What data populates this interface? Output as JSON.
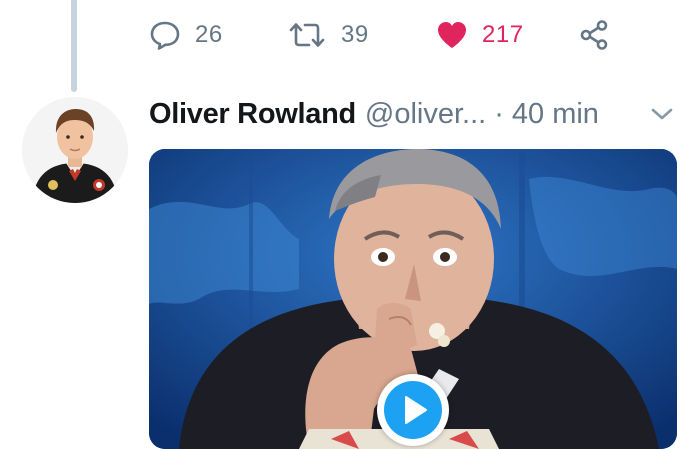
{
  "tweet_prev": {
    "reply_count": "26",
    "retweet_count": "39",
    "like_count": "217"
  },
  "tweet": {
    "display_name": "Oliver Rowland",
    "handle": "@oliver...",
    "separator": "·",
    "time": "40 min"
  },
  "icons": {
    "reply": "speech-bubble-icon",
    "retweet": "retweet-arrows-icon",
    "like": "heart-icon",
    "share": "share-nodes-icon",
    "caret": "chevron-down-icon",
    "play": "play-icon"
  },
  "colors": {
    "like": "#e0245e",
    "muted": "#657786",
    "accent": "#1da1f2",
    "thread_line": "#c6d3df"
  }
}
